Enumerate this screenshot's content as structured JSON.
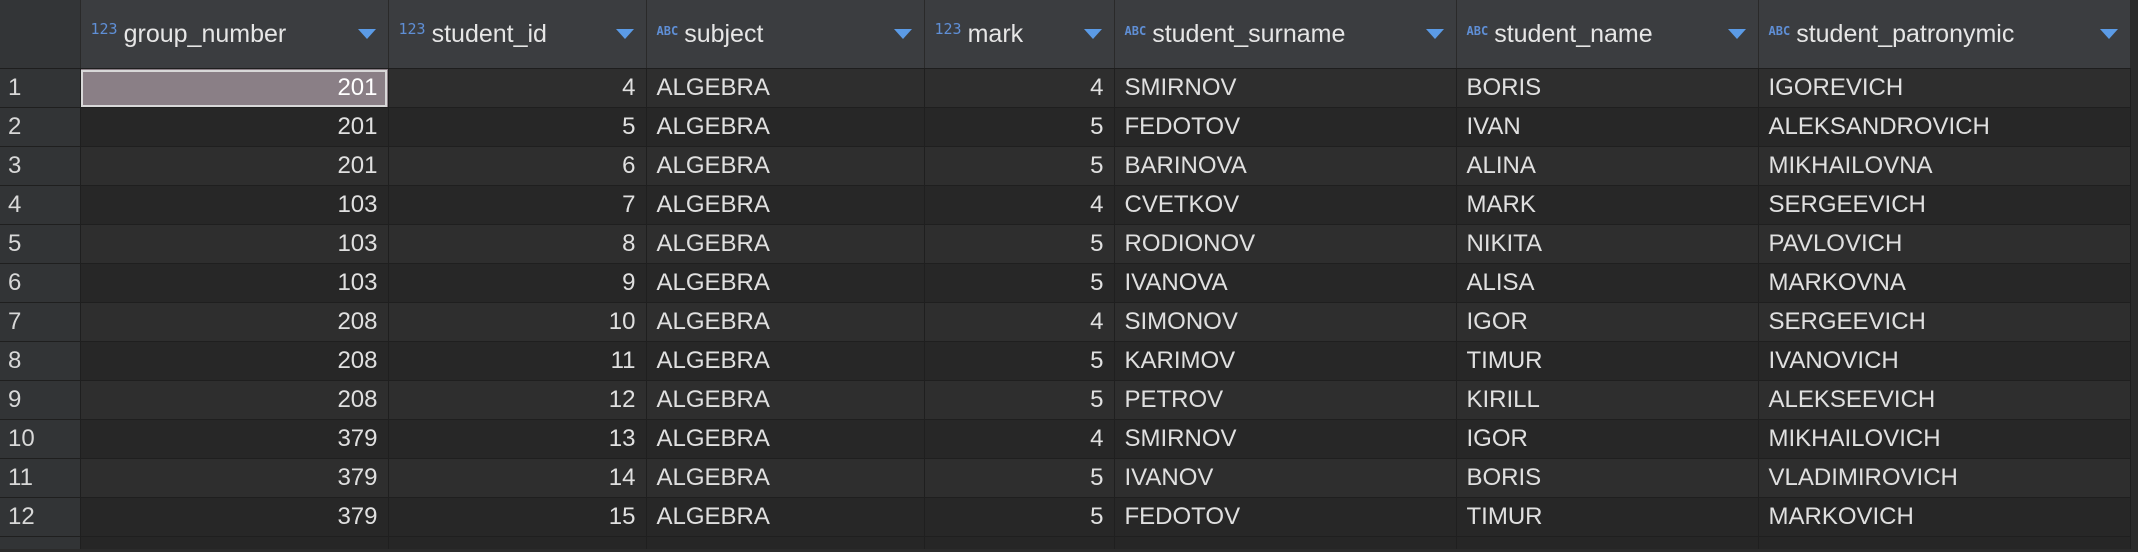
{
  "columns": [
    {
      "type": "123",
      "label": "group_number"
    },
    {
      "type": "123",
      "label": "student_id"
    },
    {
      "type": "ABC",
      "label": "subject"
    },
    {
      "type": "123",
      "label": "mark"
    },
    {
      "type": "ABC",
      "label": "student_surname"
    },
    {
      "type": "ABC",
      "label": "student_name"
    },
    {
      "type": "ABC",
      "label": "student_patronymic"
    }
  ],
  "rows": [
    {
      "n": "1",
      "group_number": "201",
      "student_id": "4",
      "subject": "ALGEBRA",
      "mark": "4",
      "student_surname": "SMIRNOV",
      "student_name": "BORIS",
      "student_patronymic": "IGOREVICH"
    },
    {
      "n": "2",
      "group_number": "201",
      "student_id": "5",
      "subject": "ALGEBRA",
      "mark": "5",
      "student_surname": "FEDOTOV",
      "student_name": "IVAN",
      "student_patronymic": "ALEKSANDROVICH"
    },
    {
      "n": "3",
      "group_number": "201",
      "student_id": "6",
      "subject": "ALGEBRA",
      "mark": "5",
      "student_surname": "BARINOVA",
      "student_name": "ALINA",
      "student_patronymic": "MIKHAILOVNA"
    },
    {
      "n": "4",
      "group_number": "103",
      "student_id": "7",
      "subject": "ALGEBRA",
      "mark": "4",
      "student_surname": "CVETKOV",
      "student_name": "MARK",
      "student_patronymic": "SERGEEVICH"
    },
    {
      "n": "5",
      "group_number": "103",
      "student_id": "8",
      "subject": "ALGEBRA",
      "mark": "5",
      "student_surname": "RODIONOV",
      "student_name": "NIKITA",
      "student_patronymic": "PAVLOVICH"
    },
    {
      "n": "6",
      "group_number": "103",
      "student_id": "9",
      "subject": "ALGEBRA",
      "mark": "5",
      "student_surname": "IVANOVA",
      "student_name": "ALISA",
      "student_patronymic": "MARKOVNA"
    },
    {
      "n": "7",
      "group_number": "208",
      "student_id": "10",
      "subject": "ALGEBRA",
      "mark": "4",
      "student_surname": "SIMONOV",
      "student_name": "IGOR",
      "student_patronymic": "SERGEEVICH"
    },
    {
      "n": "8",
      "group_number": "208",
      "student_id": "11",
      "subject": "ALGEBRA",
      "mark": "5",
      "student_surname": "KARIMOV",
      "student_name": "TIMUR",
      "student_patronymic": "IVANOVICH"
    },
    {
      "n": "9",
      "group_number": "208",
      "student_id": "12",
      "subject": "ALGEBRA",
      "mark": "5",
      "student_surname": "PETROV",
      "student_name": "KIRILL",
      "student_patronymic": "ALEKSEEVICH"
    },
    {
      "n": "10",
      "group_number": "379",
      "student_id": "13",
      "subject": "ALGEBRA",
      "mark": "4",
      "student_surname": "SMIRNOV",
      "student_name": "IGOR",
      "student_patronymic": "MIKHAILOVICH"
    },
    {
      "n": "11",
      "group_number": "379",
      "student_id": "14",
      "subject": "ALGEBRA",
      "mark": "5",
      "student_surname": "IVANOV",
      "student_name": "BORIS",
      "student_patronymic": "VLADIMIROVICH"
    },
    {
      "n": "12",
      "group_number": "379",
      "student_id": "15",
      "subject": "ALGEBRA",
      "mark": "5",
      "student_surname": "FEDOTOV",
      "student_name": "TIMUR",
      "student_patronymic": "MARKOVICH"
    }
  ],
  "selection": {
    "row": "1",
    "column": "group_number"
  },
  "colors": {
    "background": "#2b2b2b",
    "header": "#3b3d40",
    "type_icon": "#5f8fd6",
    "sort_arrow": "#5b9be6",
    "selected_cell": "#8a7f86"
  }
}
